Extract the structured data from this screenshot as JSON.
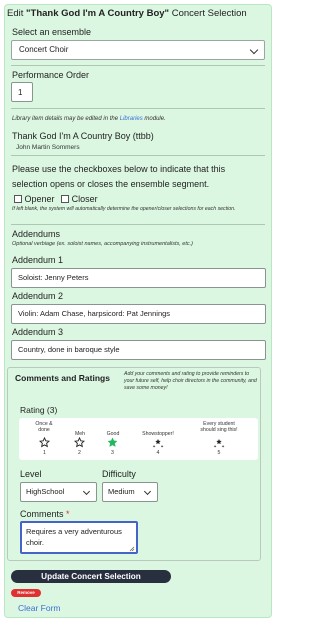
{
  "title": {
    "prefix": "Edit ",
    "work": "\"Thank God I'm A Country Boy\"",
    "suffix": " Concert Selection"
  },
  "ensemble": {
    "label": "Select an ensemble",
    "value": "Concert Choir"
  },
  "performance_order": {
    "label": "Performance Order",
    "value": "1"
  },
  "library_note": {
    "before": "Library item details may be edited in the ",
    "link": "Libraries",
    "after": " module."
  },
  "work": {
    "title": "Thank God I'm A Country Boy (ttbb)",
    "composer": "John Martin Sommers"
  },
  "segment": {
    "instructions": "Please use the checkboxes below to indicate that this selection opens or closes the ensemble segment.",
    "opener_label": "Opener",
    "closer_label": "Closer",
    "note": "If left blank, the system will automatically determine the opener/closer selections for each section."
  },
  "addendums": {
    "heading": "Addendums",
    "subheading": "Optional verbiage (ex. soloist names, accompanying instrumentalists, etc.)",
    "items": [
      {
        "label": "Addendum 1",
        "value": "Soloist: Jenny Peters"
      },
      {
        "label": "Addendum 2",
        "value": "Violin: Adam Chase, harpsicord: Pat Jennings"
      },
      {
        "label": "Addendum 3",
        "value": "Country, done in baroque style"
      }
    ]
  },
  "comments": {
    "heading": "Comments and Ratings",
    "blurb": "Add your comments and rating to provide reminders to your future self, help choir directors in the community, and save some money!",
    "rating_label": "Rating (3)",
    "rating_value": 3,
    "rating_options": [
      {
        "label_1": "Once &",
        "label_2": "done",
        "num": "1",
        "icon": "outline-star-icon"
      },
      {
        "label_1": "Meh",
        "label_2": "",
        "num": "2",
        "icon": "outline-star-icon"
      },
      {
        "label_1": "Good",
        "label_2": "",
        "num": "3",
        "icon": "filled-star-icon"
      },
      {
        "label_1": "Showstopper!",
        "label_2": "",
        "num": "4",
        "icon": "sparkle-star-icon"
      },
      {
        "label_1": "Every student",
        "label_2": "should sing this!",
        "num": "5",
        "icon": "sparkle-star-icon"
      }
    ],
    "level_label": "Level",
    "level_value": "HighSchool",
    "difficulty_label": "Difficulty",
    "difficulty_value": "Medium",
    "comments_label": "Comments",
    "required_mark": "*",
    "comments_line_1": "Requires a very adventurous",
    "comments_line_2": "choir."
  },
  "actions": {
    "update_label": "Update Concert Selection",
    "remove_label": "Remove",
    "clear_label": "Clear Form"
  },
  "colors": {
    "panel_bg": "#dcf7e1",
    "star_filled": "#22b860",
    "primary_button": "#283040",
    "danger": "#e03030",
    "link": "#3b6fd6",
    "focus": "#4664c8"
  }
}
